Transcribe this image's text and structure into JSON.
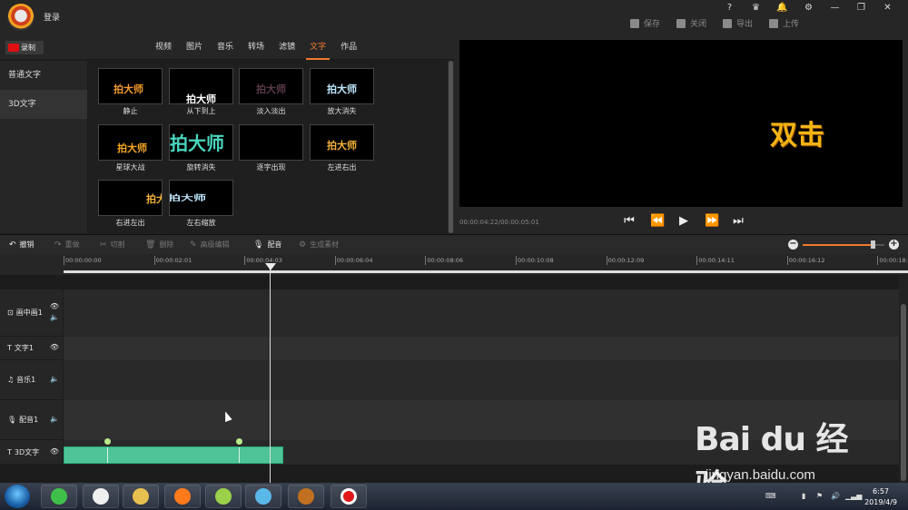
{
  "titlebar": {
    "login": "登录",
    "window_icons": [
      "?",
      "VIP",
      "bell",
      "gear",
      "minimize",
      "restore",
      "close"
    ],
    "actions": [
      {
        "label": "保存",
        "icon": "save-icon"
      },
      {
        "label": "关闭",
        "icon": "exit-icon"
      },
      {
        "label": "导出",
        "icon": "export-icon"
      },
      {
        "label": "上传",
        "icon": "upload-icon"
      }
    ]
  },
  "recorder": {
    "label": "录制"
  },
  "tabs": [
    {
      "label": "视频"
    },
    {
      "label": "图片"
    },
    {
      "label": "音乐"
    },
    {
      "label": "转场"
    },
    {
      "label": "滤镜"
    },
    {
      "label": "文字",
      "active": true
    },
    {
      "label": "作品"
    }
  ],
  "categories": [
    {
      "label": "普通文字"
    },
    {
      "label": "3D文字",
      "selected": true
    }
  ],
  "thumb_text": "拍大师",
  "effects": [
    {
      "label": "静止",
      "color": "#f39a2a"
    },
    {
      "label": "从下到上",
      "color": "#ffffff"
    },
    {
      "label": "淡入淡出",
      "color": "#5a3a4a"
    },
    {
      "label": "放大消失",
      "color": "#bfe8ff"
    },
    {
      "label": "星球大战",
      "color": "#f5a623"
    },
    {
      "label": "旋转消失",
      "color": "#4ad6c0"
    },
    {
      "label": "逐字出现",
      "color": "#000000"
    },
    {
      "label": "左进右出",
      "color": "#f5b23a"
    },
    {
      "label": "右进左出",
      "color": "#f5b23a"
    },
    {
      "label": "左右缩放",
      "color": "#bfe8ff"
    }
  ],
  "preview": {
    "text": "双击",
    "current_time": "00:00:04:22",
    "total_time": "00:00:05:01",
    "timecode_sep": "/"
  },
  "player": [
    {
      "icon": "skip-start-icon",
      "glyph": "⏮"
    },
    {
      "icon": "step-back-icon",
      "glyph": "⏪"
    },
    {
      "icon": "play-icon",
      "glyph": "▶"
    },
    {
      "icon": "step-forward-icon",
      "glyph": "⏩"
    },
    {
      "icon": "skip-end-icon",
      "glyph": "⏭"
    }
  ],
  "toolbar": [
    {
      "label": "撤销",
      "icon": "undo-icon",
      "glyph": "↶",
      "enabled": true
    },
    {
      "label": "重做",
      "icon": "redo-icon",
      "glyph": "↷",
      "enabled": false
    },
    {
      "label": "切割",
      "icon": "scissors-icon",
      "glyph": "✂",
      "enabled": false
    },
    {
      "label": "删除",
      "icon": "trash-icon",
      "glyph": "🗑",
      "enabled": false
    },
    {
      "label": "高级编辑",
      "icon": "pencil-icon",
      "glyph": "✎",
      "enabled": false
    },
    {
      "label": "配音",
      "icon": "microphone-icon",
      "glyph": "🎙",
      "enabled": true
    },
    {
      "label": "生成素材",
      "icon": "gear-icon",
      "glyph": "⚙",
      "enabled": false
    }
  ],
  "zoom": {
    "minus": "−",
    "plus": "+",
    "level": 0.85
  },
  "ruler": {
    "ticks": [
      "00:00:00:00",
      "00:00:02:01",
      "00:00:04:03",
      "00:00:06:04",
      "00:00:08:06",
      "00:00:10:08",
      "00:00:12:09",
      "00:00:14:11",
      "00:00:16:12",
      "00:00:18:1"
    ]
  },
  "tracks": [
    {
      "label": "画中画1",
      "icon": "pip-icon",
      "glyph": "⊡",
      "controls": [
        "eye",
        "speaker"
      ]
    },
    {
      "label": "文字1",
      "icon": "text-icon",
      "glyph": "T",
      "controls": [
        "eye"
      ]
    },
    {
      "label": "音乐1",
      "icon": "music-icon",
      "glyph": "♫",
      "controls": [
        "speaker"
      ]
    },
    {
      "label": "配音1",
      "icon": "microphone-icon",
      "glyph": "🎙",
      "controls": [
        "speaker"
      ]
    },
    {
      "label": "3D文字",
      "icon": "text-icon",
      "glyph": "T",
      "controls": [
        "eye"
      ]
    }
  ],
  "taskbar": {
    "apps": [
      "refresh-app",
      "qq-app",
      "explorer-app",
      "firefox-app",
      "media-app",
      "book-app",
      "recorder-app",
      "record-app"
    ],
    "clock_time": "6:57",
    "clock_date": "2019/4/9"
  },
  "watermark": {
    "brand": "Bai du 经验",
    "url": "jingyan.baidu.com"
  }
}
